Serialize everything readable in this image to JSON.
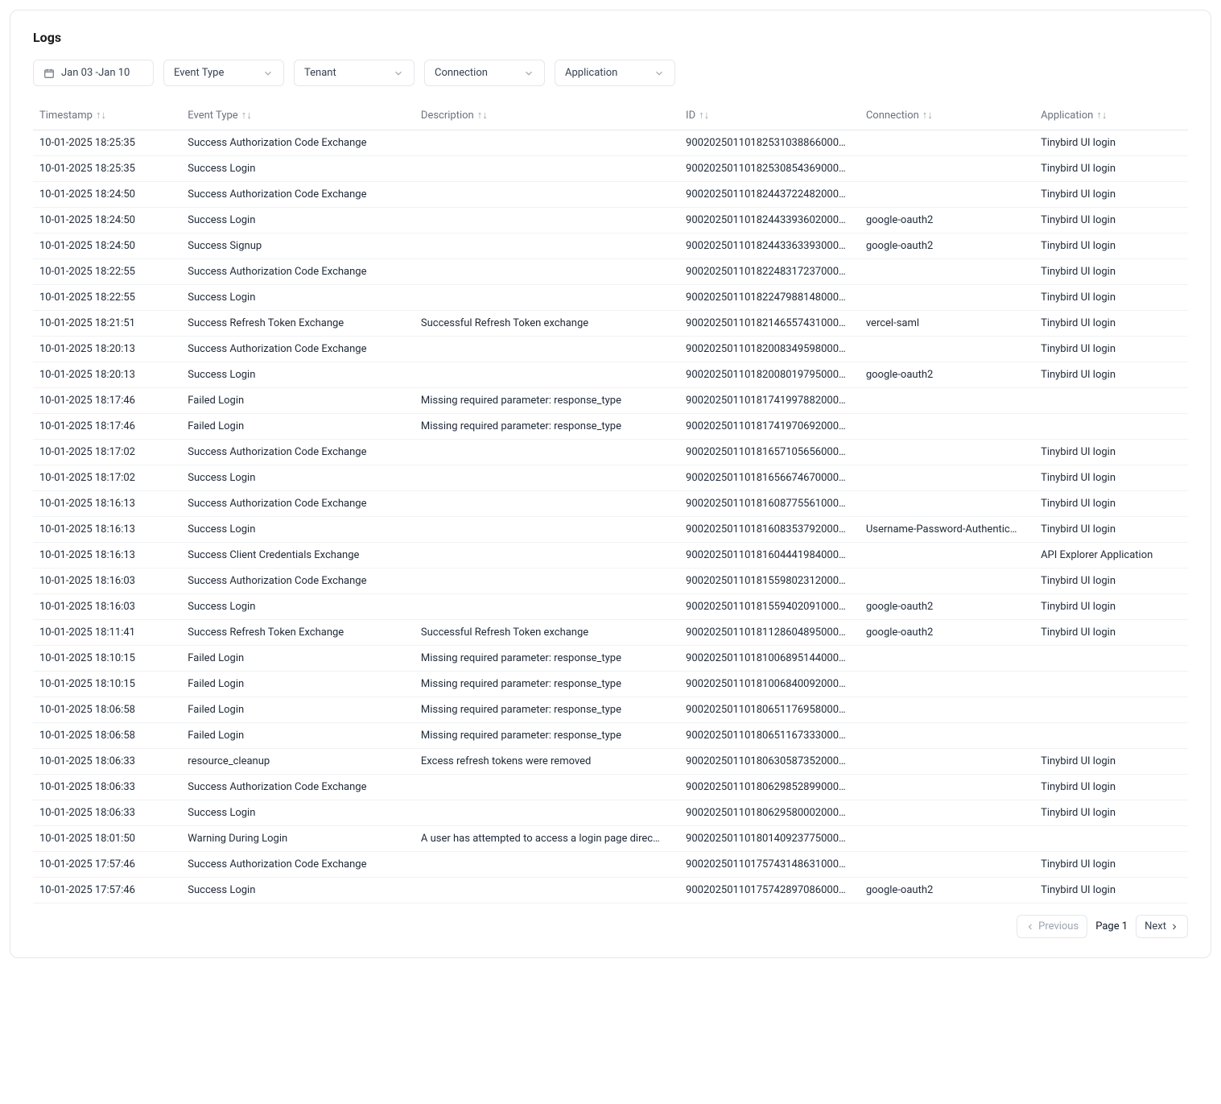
{
  "title": "Logs",
  "filters": {
    "dateRange": "Jan 03 -Jan 10",
    "eventType": "Event Type",
    "tenant": "Tenant",
    "connection": "Connection",
    "application": "Application"
  },
  "columns": {
    "timestamp": "Timestamp",
    "eventType": "Event Type",
    "description": "Description",
    "id": "ID",
    "connection": "Connection",
    "application": "Application"
  },
  "rows": [
    {
      "ts": "10-01-2025 18:25:35",
      "et": "Success Authorization Code Exchange",
      "desc": "",
      "id": "90020250110182531038866000…",
      "conn": "",
      "app": "Tinybird UI login"
    },
    {
      "ts": "10-01-2025 18:25:35",
      "et": "Success Login",
      "desc": "",
      "id": "90020250110182530854369000…",
      "conn": "",
      "app": "Tinybird UI login"
    },
    {
      "ts": "10-01-2025 18:24:50",
      "et": "Success Authorization Code Exchange",
      "desc": "",
      "id": "90020250110182443722482000…",
      "conn": "",
      "app": "Tinybird UI login"
    },
    {
      "ts": "10-01-2025 18:24:50",
      "et": "Success Login",
      "desc": "",
      "id": "90020250110182443393602000…",
      "conn": "google-oauth2",
      "app": "Tinybird UI login"
    },
    {
      "ts": "10-01-2025 18:24:50",
      "et": "Success Signup",
      "desc": "",
      "id": "90020250110182443363393000…",
      "conn": "google-oauth2",
      "app": "Tinybird UI login"
    },
    {
      "ts": "10-01-2025 18:22:55",
      "et": "Success Authorization Code Exchange",
      "desc": "",
      "id": "90020250110182248317237000…",
      "conn": "",
      "app": "Tinybird UI login"
    },
    {
      "ts": "10-01-2025 18:22:55",
      "et": "Success Login",
      "desc": "",
      "id": "90020250110182247988148000…",
      "conn": "",
      "app": "Tinybird UI login"
    },
    {
      "ts": "10-01-2025 18:21:51",
      "et": "Success Refresh Token Exchange",
      "desc": "Successful Refresh Token exchange",
      "id": "90020250110182146557431000…",
      "conn": "vercel-saml",
      "app": "Tinybird UI login"
    },
    {
      "ts": "10-01-2025 18:20:13",
      "et": "Success Authorization Code Exchange",
      "desc": "",
      "id": "90020250110182008349598000…",
      "conn": "",
      "app": "Tinybird UI login"
    },
    {
      "ts": "10-01-2025 18:20:13",
      "et": "Success Login",
      "desc": "",
      "id": "90020250110182008019795000…",
      "conn": "google-oauth2",
      "app": "Tinybird UI login"
    },
    {
      "ts": "10-01-2025 18:17:46",
      "et": "Failed Login",
      "desc": "Missing required parameter: response_type",
      "id": "90020250110181741997882000…",
      "conn": "",
      "app": ""
    },
    {
      "ts": "10-01-2025 18:17:46",
      "et": "Failed Login",
      "desc": "Missing required parameter: response_type",
      "id": "90020250110181741970692000…",
      "conn": "",
      "app": ""
    },
    {
      "ts": "10-01-2025 18:17:02",
      "et": "Success Authorization Code Exchange",
      "desc": "",
      "id": "90020250110181657105656000…",
      "conn": "",
      "app": "Tinybird UI login"
    },
    {
      "ts": "10-01-2025 18:17:02",
      "et": "Success Login",
      "desc": "",
      "id": "90020250110181656674670000…",
      "conn": "",
      "app": "Tinybird UI login"
    },
    {
      "ts": "10-01-2025 18:16:13",
      "et": "Success Authorization Code Exchange",
      "desc": "",
      "id": "90020250110181608775561000…",
      "conn": "",
      "app": "Tinybird UI login"
    },
    {
      "ts": "10-01-2025 18:16:13",
      "et": "Success Login",
      "desc": "",
      "id": "90020250110181608353792000…",
      "conn": "Username-Password-Authentic…",
      "app": "Tinybird UI login"
    },
    {
      "ts": "10-01-2025 18:16:13",
      "et": "Success Client Credentials Exchange",
      "desc": "",
      "id": "90020250110181604441984000…",
      "conn": "",
      "app": "API Explorer Application"
    },
    {
      "ts": "10-01-2025 18:16:03",
      "et": "Success Authorization Code Exchange",
      "desc": "",
      "id": "90020250110181559802312000…",
      "conn": "",
      "app": "Tinybird UI login"
    },
    {
      "ts": "10-01-2025 18:16:03",
      "et": "Success Login",
      "desc": "",
      "id": "90020250110181559402091000…",
      "conn": "google-oauth2",
      "app": "Tinybird UI login"
    },
    {
      "ts": "10-01-2025 18:11:41",
      "et": "Success Refresh Token Exchange",
      "desc": "Successful Refresh Token exchange",
      "id": "90020250110181128604895000…",
      "conn": "google-oauth2",
      "app": "Tinybird UI login"
    },
    {
      "ts": "10-01-2025 18:10:15",
      "et": "Failed Login",
      "desc": "Missing required parameter: response_type",
      "id": "90020250110181006895144000…",
      "conn": "",
      "app": ""
    },
    {
      "ts": "10-01-2025 18:10:15",
      "et": "Failed Login",
      "desc": "Missing required parameter: response_type",
      "id": "90020250110181006840092000…",
      "conn": "",
      "app": ""
    },
    {
      "ts": "10-01-2025 18:06:58",
      "et": "Failed Login",
      "desc": "Missing required parameter: response_type",
      "id": "90020250110180651176958000…",
      "conn": "",
      "app": ""
    },
    {
      "ts": "10-01-2025 18:06:58",
      "et": "Failed Login",
      "desc": "Missing required parameter: response_type",
      "id": "90020250110180651167333000…",
      "conn": "",
      "app": ""
    },
    {
      "ts": "10-01-2025 18:06:33",
      "et": "resource_cleanup",
      "desc": "Excess refresh tokens were removed",
      "id": "90020250110180630587352000…",
      "conn": "",
      "app": "Tinybird UI login"
    },
    {
      "ts": "10-01-2025 18:06:33",
      "et": "Success Authorization Code Exchange",
      "desc": "",
      "id": "90020250110180629852899000…",
      "conn": "",
      "app": "Tinybird UI login"
    },
    {
      "ts": "10-01-2025 18:06:33",
      "et": "Success Login",
      "desc": "",
      "id": "90020250110180629580002000…",
      "conn": "",
      "app": "Tinybird UI login"
    },
    {
      "ts": "10-01-2025 18:01:50",
      "et": "Warning During Login",
      "desc": "A user has attempted to access a login page direc…",
      "id": "90020250110180140923775000…",
      "conn": "",
      "app": ""
    },
    {
      "ts": "10-01-2025 17:57:46",
      "et": "Success Authorization Code Exchange",
      "desc": "",
      "id": "90020250110175743148631000…",
      "conn": "",
      "app": "Tinybird UI login"
    },
    {
      "ts": "10-01-2025 17:57:46",
      "et": "Success Login",
      "desc": "",
      "id": "90020250110175742897086000…",
      "conn": "google-oauth2",
      "app": "Tinybird UI login"
    }
  ],
  "pager": {
    "prev": "Previous",
    "page": "Page 1",
    "next": "Next"
  }
}
